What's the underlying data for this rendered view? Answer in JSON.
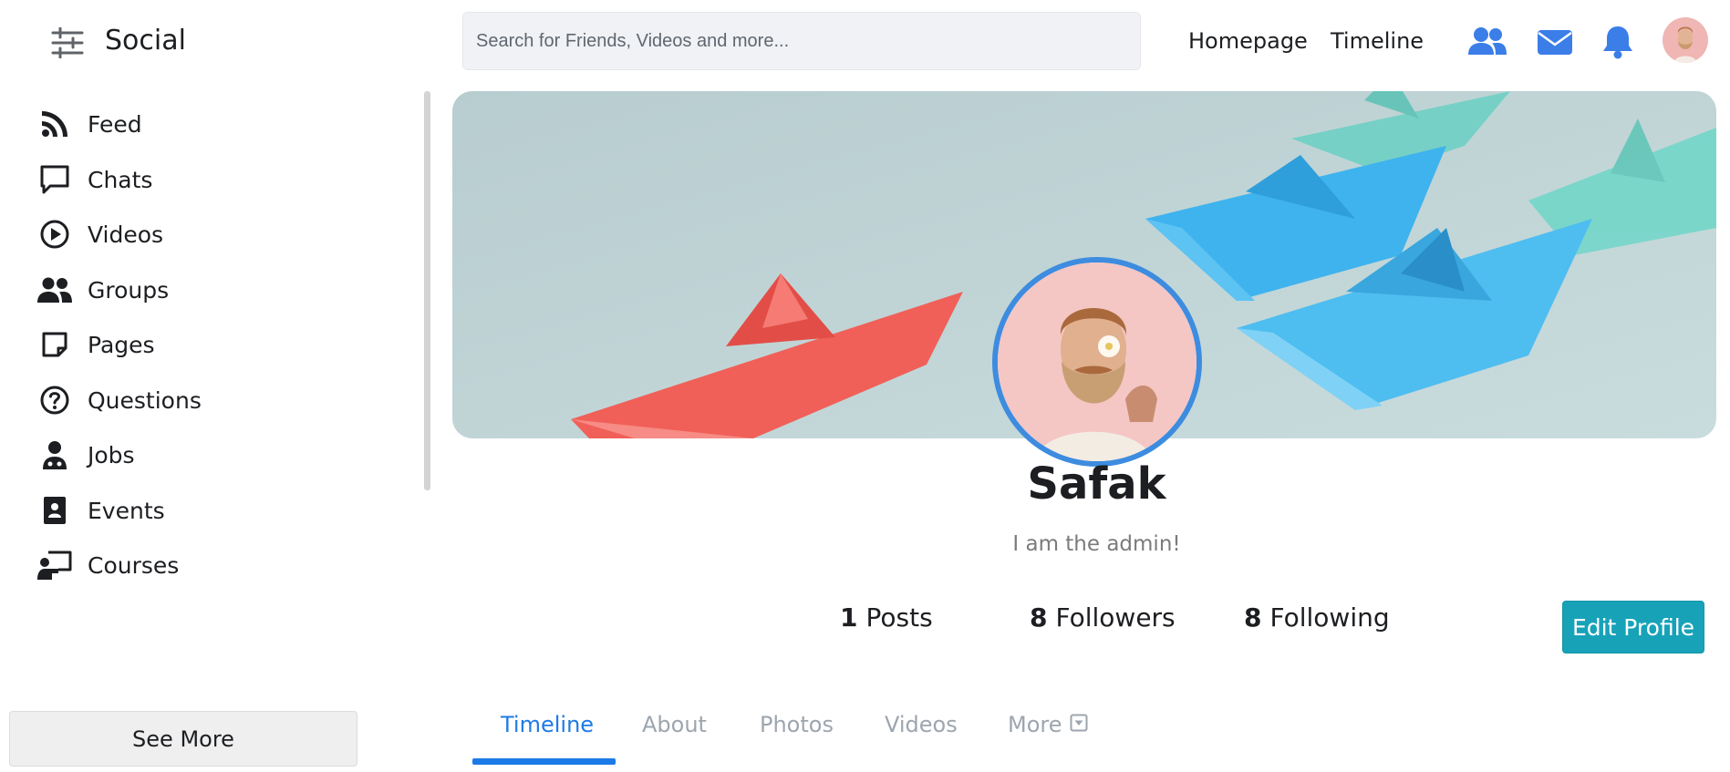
{
  "header": {
    "brand": "Social",
    "search_placeholder": "Search for Friends, Videos and more...",
    "links": [
      {
        "label": "Homepage"
      },
      {
        "label": "Timeline"
      }
    ],
    "icons": [
      "friends-icon",
      "mail-icon",
      "bell-icon"
    ],
    "accent_color": "#3b7ee8"
  },
  "sidebar": {
    "items": [
      {
        "label": "Feed",
        "icon": "rss-icon"
      },
      {
        "label": "Chats",
        "icon": "chat-icon"
      },
      {
        "label": "Videos",
        "icon": "play-icon"
      },
      {
        "label": "Groups",
        "icon": "users-icon"
      },
      {
        "label": "Pages",
        "icon": "note-icon"
      },
      {
        "label": "Questions",
        "icon": "question-icon"
      },
      {
        "label": "Jobs",
        "icon": "doctor-icon"
      },
      {
        "label": "Events",
        "icon": "contact-book-icon"
      },
      {
        "label": "Courses",
        "icon": "teacher-icon"
      }
    ],
    "see_more": "See More"
  },
  "profile": {
    "name": "Safak",
    "bio": "I am the admin!",
    "stats": [
      {
        "value": "1",
        "label": "Posts"
      },
      {
        "value": "8",
        "label": "Followers"
      },
      {
        "value": "8",
        "label": "Following"
      }
    ],
    "edit_button": "Edit Profile",
    "ring_color": "#3d8cdf",
    "button_color": "#17a2b8"
  },
  "tabs": [
    {
      "label": "Timeline",
      "active": true
    },
    {
      "label": "About",
      "active": false
    },
    {
      "label": "Photos",
      "active": false
    },
    {
      "label": "Videos",
      "active": false
    },
    {
      "label": "More",
      "active": false
    }
  ]
}
